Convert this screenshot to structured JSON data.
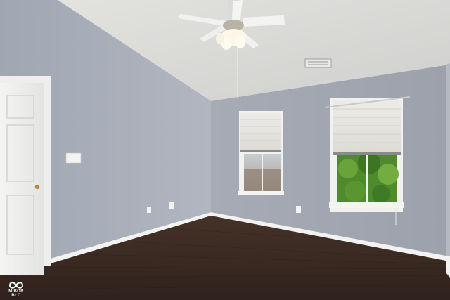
{
  "photo": {
    "subject": "empty-room",
    "colors": {
      "left_wall": "#a7aeb9",
      "back_wall": "#a3a8b3",
      "ceiling": "#d8d8d6",
      "floor": "#3a2a22",
      "trim": "#f4f4f2",
      "foliage": "#4f8a2c"
    }
  },
  "watermark": {
    "text": "MIBOR BLC",
    "icon": "infinity-logo-icon"
  }
}
